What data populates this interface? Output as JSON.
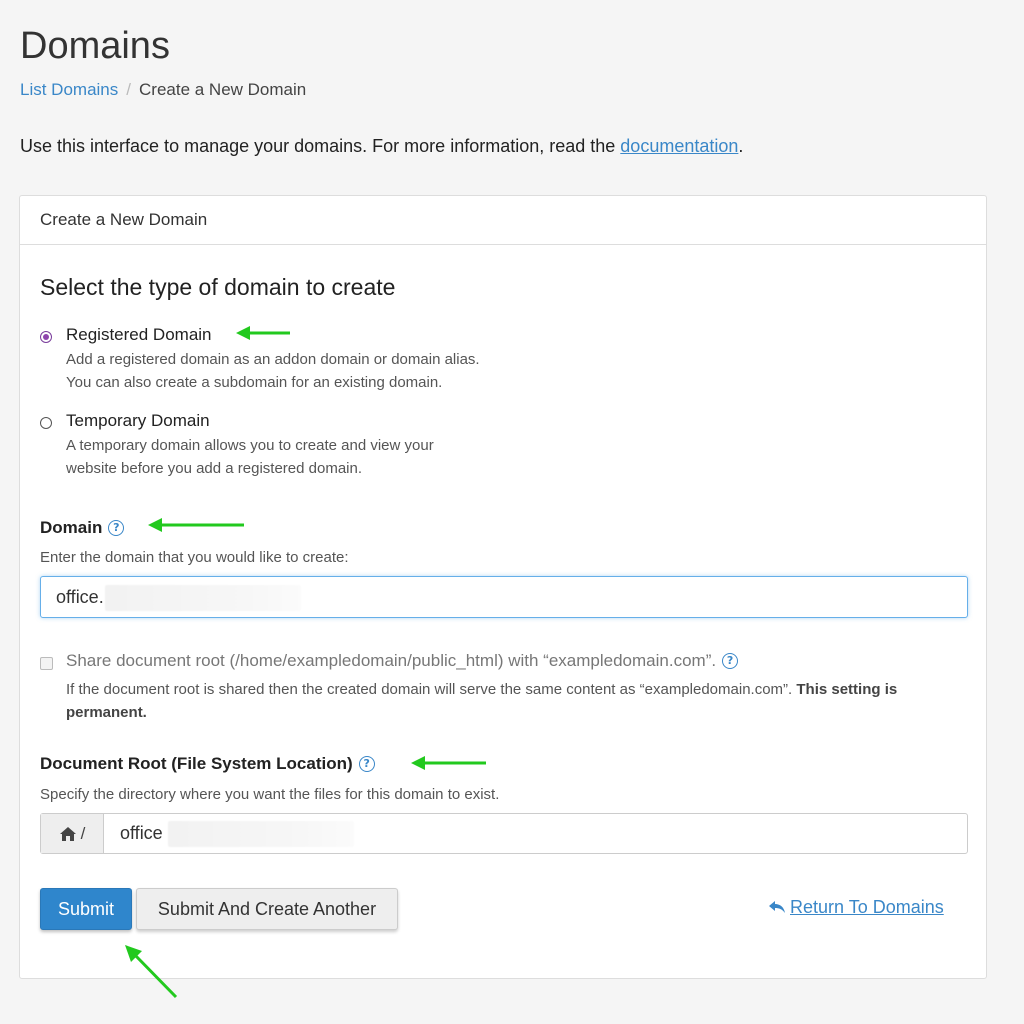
{
  "page": {
    "title": "Domains"
  },
  "breadcrumb": {
    "parent": "List Domains",
    "separator": "/",
    "current": "Create a New Domain"
  },
  "intro": {
    "text": "Use this interface to manage your domains. For more information, read the ",
    "link": "documentation",
    "suffix": "."
  },
  "panel": {
    "header": "Create a New Domain",
    "section_title": "Select the type of domain to create",
    "options": [
      {
        "label": "Registered Domain",
        "selected": true,
        "desc_line1": "Add a registered domain as an addon domain or domain alias.",
        "desc_line2": "You can also create a subdomain for an existing domain."
      },
      {
        "label": "Temporary Domain",
        "selected": false,
        "desc_line1": "A temporary domain allows you to create and view your",
        "desc_line2": "website before you add a registered domain."
      }
    ],
    "domain": {
      "label": "Domain",
      "help": "Enter the domain that you would like to create:",
      "value": "office."
    },
    "share": {
      "label": "Share document root (/home/exampledomain/public_html) with “exampledomain.com”.",
      "desc": "If the document root is shared then the created domain will serve the same content as “exampledomain.com”. ",
      "desc_bold": "This setting is permanent.",
      "checked": false
    },
    "docroot": {
      "label": "Document Root (File System Location)",
      "help": "Specify the directory where you want the files for this domain to exist.",
      "prefix": "/",
      "value": "office"
    },
    "buttons": {
      "submit": "Submit",
      "submit_another": "Submit And Create Another",
      "return": "Return To Domains"
    }
  },
  "icons": {
    "help": "question-circle-icon",
    "home": "home-icon",
    "return": "reply-icon"
  },
  "colors": {
    "accent": "#2f86cc",
    "link": "#3a87c8",
    "radio_selected": "#8e44ad",
    "annotation_arrow": "#22c91e"
  }
}
